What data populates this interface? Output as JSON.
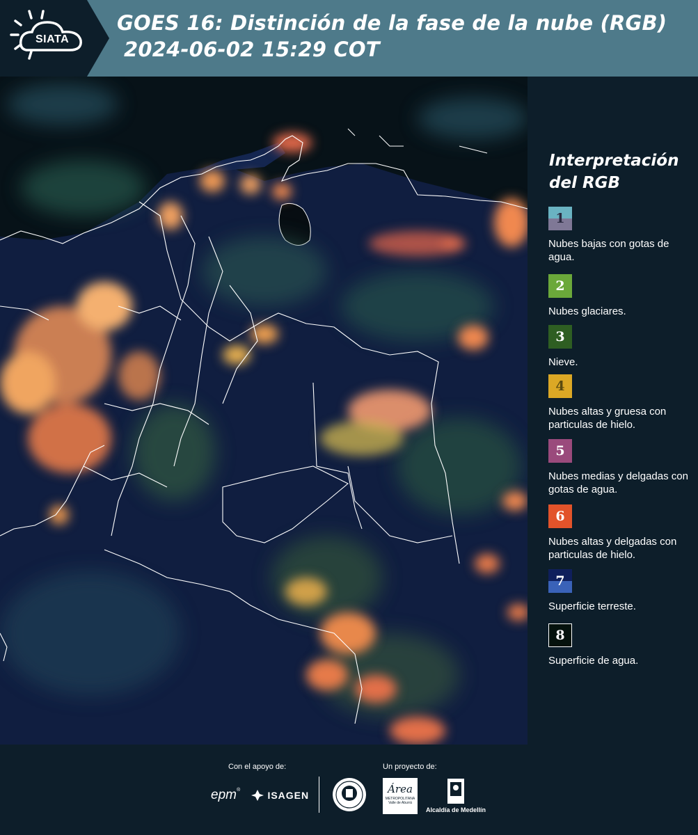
{
  "header": {
    "logo_text": "SIATA",
    "title_line1": "GOES 16: Distinción de la fase de la nube (RGB)",
    "title_line2": "2024-06-02 15:29 COT"
  },
  "legend": {
    "title": "Interpretación del RGB",
    "items": [
      {
        "number": "1",
        "label": "Nubes bajas con gotas de agua.",
        "color_top": "#6ab3c2",
        "color_bottom": "#7f7896"
      },
      {
        "number": "2",
        "label": "Nubes glaciares.",
        "color": "#6ba83a"
      },
      {
        "number": "3",
        "label": "Nieve.",
        "color": "#2e5e22"
      },
      {
        "number": "4",
        "label": "Nubes altas y gruesa con particulas de hielo.",
        "color": "#dca825"
      },
      {
        "number": "5",
        "label": "Nubes medias y delgadas con gotas de agua.",
        "color": "#9a4a7c"
      },
      {
        "number": "6",
        "label": "Nubes altas y delgadas con particulas de hielo.",
        "color": "#e2532a"
      },
      {
        "number": "7",
        "label": "Superficie terreste.",
        "color_top": "#0f1f5c",
        "color_bottom": "#3a62b8"
      },
      {
        "number": "8",
        "label": "Superficie de agua.",
        "color": "#05120d"
      }
    ]
  },
  "footer": {
    "support_label": "Con el apoyo de:",
    "project_label": "Un proyecto de:",
    "sponsor_1": "epm",
    "sponsor_2": "ISAGEN",
    "partner_area_1": "Área",
    "partner_area_2": "METROPOLITANA",
    "partner_area_3": "Valle de Aburrá",
    "partner_alcaldia": "Alcaldía de Medellín"
  }
}
